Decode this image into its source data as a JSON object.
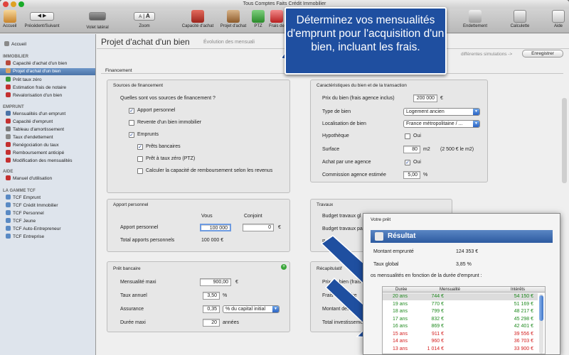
{
  "window": {
    "title": "Tous Comptes Faits Crédit Immobilier"
  },
  "toolbar": {
    "accueil": "Accueil",
    "nav": "Précédent/Suivant",
    "volet": "Volet latéral",
    "zoom": "Zoom",
    "capacite": "Capacité d'achat",
    "projet": "Projet d'achat",
    "ptz": "PTZ",
    "frais": "Frais de",
    "endettement": "Endettement",
    "calculette": "Calculette",
    "aide": "Aide",
    "zoom_a_small": "A",
    "zoom_a_big": "A"
  },
  "sidebar": {
    "accueil": "Accueil",
    "immobilier_head": "IMMOBILIER",
    "immobilier": [
      "Capacité d'achat d'un bien",
      "Projet d'achat d'un bien",
      "Prêt taux zéro",
      "Estimation frais de notaire",
      "Revalorisation d'un bien"
    ],
    "emprunt_head": "EMPRUNT",
    "emprunt": [
      "Mensualités d'un emprunt",
      "Capacité d'emprunt",
      "Tableau d'amortissement",
      "Taux d'endettement",
      "Renégociation du taux",
      "Remboursement anticipé",
      "Modification des mensualités"
    ],
    "aide_head": "AIDE",
    "aide": [
      "Manuel d'utilisation"
    ],
    "gamme_head": "LA GAMME TCF",
    "gamme": [
      "TCF Emprunt",
      "TCF Crédit Immobilier",
      "TCF Personnel",
      "TCF Jeune",
      "TCF Auto-Entrepreneur",
      "TCF Entreprise"
    ]
  },
  "main": {
    "title": "Projet d'achat d'un bien",
    "tab2": "Évolution des mensuali",
    "sim_text": "différentes simulations ->",
    "save_button": "Enregistrer",
    "financement": "Financement",
    "sources": {
      "title": "Sources de financement",
      "question": "Quelles sont vos sources de financement ?",
      "apport": "Apport personnel",
      "revente": "Revente d'un bien immobilier",
      "emprunts": "Emprunts",
      "prets_bancaires": "Prêts bancaires",
      "ptz": "Prêt à taux zéro (PTZ)",
      "calcul": "Calculer la capacité de remboursement selon les revenus"
    },
    "apport": {
      "title": "Apport personnel",
      "vous": "Vous",
      "conjoint": "Conjoint",
      "label": "Apport personnel",
      "vous_val": "100 000",
      "conj_val": "0",
      "unit": "€",
      "total_label": "Total apports personnels",
      "total_val": "100 000 €"
    },
    "pret": {
      "title": "Prêt bancaire",
      "mens_label": "Mensualité maxi",
      "mens_val": "900,00",
      "mens_unit": "€",
      "taux_label": "Taux annuel",
      "taux_val": "3,50",
      "taux_unit": "%",
      "assur_label": "Assurance",
      "assur_val": "0,35",
      "assur_sel": "% du capital initial",
      "duree_label": "Durée maxi",
      "duree_val": "20",
      "duree_unit": "années"
    },
    "caract": {
      "title": "Caractéristiques du bien et de la transaction",
      "prix_label": "Prix du bien (frais agence inclus)",
      "prix_val": "200 000",
      "prix_unit": "€",
      "type_label": "Type de bien",
      "type_val": "Logement ancien",
      "loc_label": "Localisation de bien",
      "loc_val": "France métropolitaine / ...",
      "hypo_label": "Hypothèque",
      "hypo_oui": "Oui",
      "surf_label": "Surface",
      "surf_val": "80",
      "surf_unit": "m2",
      "surf_price": "(2 500 € le m2)",
      "agence_label": "Achat par une agence",
      "agence_oui": "Oui",
      "comm_label": "Commission agence estimée",
      "comm_val": "5,00",
      "comm_unit": "%"
    },
    "travaux": {
      "title": "Travaux",
      "budget_label": "Budget travaux gl",
      "budget2_label": "Budget travaux pa",
      "label3": "Budget"
    },
    "recap": {
      "title": "Récapitulatif",
      "prix_label": "Prix du bien (frais",
      "notaire_label": "Frais de notaire",
      "montant_label": "Montant des trava",
      "total_label": "Total investisseme"
    }
  },
  "callout": {
    "text": "Déterminez vos mensualités d'emprunt pour l'acquisition d'un bien, incluant les frais."
  },
  "result": {
    "panel_title": "Votre prêt",
    "title": "Résultat",
    "montant_label": "Montant emprunté",
    "montant_val": "124 353 €",
    "taux_label": "Taux global",
    "taux_val": "3,85 %",
    "table_caption": "os mensualités en fonction de la durée d'emprunt :",
    "headers": [
      "Durée",
      "Mensualité",
      "Intérêts"
    ],
    "rows": [
      {
        "duree": "20 ans",
        "mens": "744 €",
        "int": "54 150 €",
        "color": "green"
      },
      {
        "duree": "19 ans",
        "mens": "770 €",
        "int": "51 169 €",
        "color": "green"
      },
      {
        "duree": "18 ans",
        "mens": "799 €",
        "int": "48 217 €",
        "color": "green"
      },
      {
        "duree": "17 ans",
        "mens": "832 €",
        "int": "45 298 €",
        "color": "green"
      },
      {
        "duree": "16 ans",
        "mens": "869 €",
        "int": "42 401 €",
        "color": "green"
      },
      {
        "duree": "15 ans",
        "mens": "911 €",
        "int": "39 556 €",
        "color": "red"
      },
      {
        "duree": "14 ans",
        "mens": "960 €",
        "int": "36 703 €",
        "color": "red"
      },
      {
        "duree": "13 ans",
        "mens": "1 014 €",
        "int": "33 900 €",
        "color": "red"
      }
    ]
  },
  "colors": {
    "green": "#1f8a1f",
    "red": "#d42020",
    "callout": "#1f4fa0",
    "selection": "#4a73a8"
  }
}
